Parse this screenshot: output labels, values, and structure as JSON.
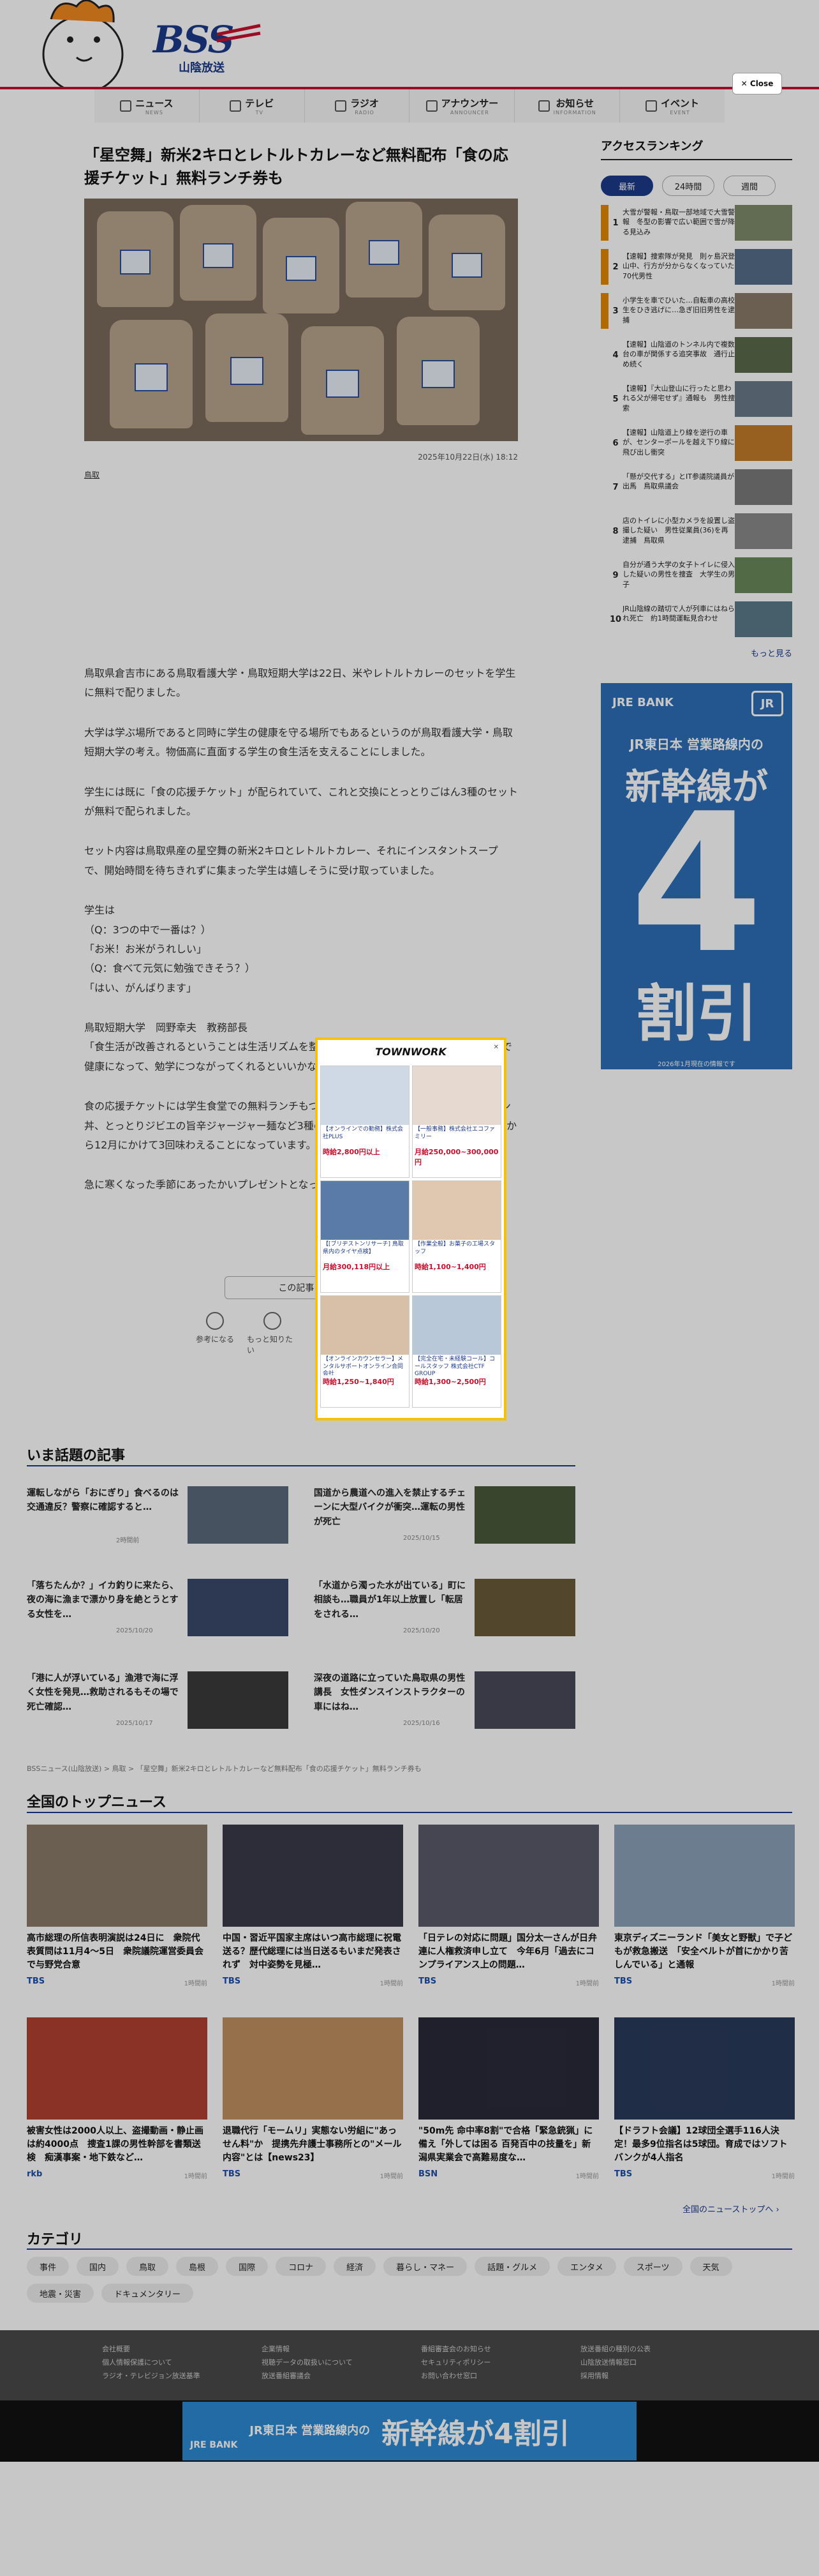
{
  "header": {
    "logo_text": "BSS",
    "logo_sub": "山陰放送",
    "close_label": "Close",
    "nav": [
      {
        "ja": "ニュース",
        "en": "NEWS",
        "icon": "tv-icon"
      },
      {
        "ja": "テレビ",
        "en": "TV",
        "icon": "tv-icon"
      },
      {
        "ja": "ラジオ",
        "en": "RADIO",
        "icon": "radio-icon"
      },
      {
        "ja": "アナウンサー",
        "en": "ANNOUNCER",
        "icon": "mic-icon"
      },
      {
        "ja": "お知らせ",
        "en": "INFORMATION",
        "icon": "info-icon"
      },
      {
        "ja": "イベント",
        "en": "EVENT",
        "icon": "calendar-icon"
      }
    ]
  },
  "article": {
    "title": "「星空舞」新米2キロとレトルトカレーなど無料配布「食の応援チケット」無料ランチ券も",
    "date": "2025年10月22日(水) 18:12",
    "tag": "鳥取",
    "paragraphs": [
      "鳥取県倉吉市にある鳥取看護大学・鳥取短期大学は22日、米やレトルトカレーのセットを学生に無料で配りました。",
      "大学は学ぶ場所であると同時に学生の健康を守る場所でもあるというのが鳥取看護大学・鳥取短期大学の考え。物価高に直面する学生の食生活を支えることにしました。",
      "学生には既に「食の応援チケット」が配られていて、これと交換にとっとりごはん3種のセットが無料で配られました。",
      "セット内容は鳥取県産の星空舞の新米2キロとレトルトカレー、それにインスタントスープで、開始時間を待ちきれずに集まった学生は嬉しそうに受け取っていました。",
      "学生は\n（Q：3つの中で一番は？）\n「お米！お米がうれしい」\n（Q：食べて元気に勉強できそう？）\n「はい、がんばります」",
      "鳥取短期大学　岡野幸夫　教務部長\n「食生活が改善されるということは生活リズムを整えることにもつながる。そうしたところで健康になって、勉学につながってくれるといいかなと」",
      "食の応援チケットには学生食堂での無料ランチもついていて、学生は鳥取名物の牛骨ラーメン丼、とっとりジビエの旨辛ジャージャー麺など3種の中から選べます。この無料ランチが来月から12月にかけて3回味わえることになっています。",
      "急に寒くなった季節にあったかいプレゼントとなったようです。"
    ],
    "share_label": "この記事を読んで",
    "reactions": [
      "参考になる",
      "もっと知りたい"
    ]
  },
  "ranking": {
    "title": "アクセスランキング",
    "tabs": [
      "最新",
      "24時間",
      "週間"
    ],
    "active_tab": "最新",
    "items": [
      {
        "rank": "1",
        "text": "大雪が警報・鳥取一部地域で大雪警報　冬型の影響で広い範囲で雪が降る見込み"
      },
      {
        "rank": "2",
        "text": "【速報】捜索隊が発見　則ヶ島沢登山中、行方が分からなくなっていた70代男性"
      },
      {
        "rank": "3",
        "text": "小学生を車でひいた…自転車の高校生をひき逃げに…急ぎ旧旧男性を逮捕"
      },
      {
        "rank": "4",
        "text": "【速報】山陰道のトンネル内で複数台の車が関係する追突事故　通行止め続く"
      },
      {
        "rank": "5",
        "text": "【速報】『大山登山に行ったと思われる父が帰宅せず』通報も　男性捜索"
      },
      {
        "rank": "6",
        "text": "【速報】山陰道上り線を逆行の車が、センターポールを越え下り線に飛び出し衝突"
      },
      {
        "rank": "7",
        "text": "「懸が交代する」とIT参議院議員が出馬　鳥取県議会"
      },
      {
        "rank": "8",
        "text": "店のトイレに小型カメラを設置し盗撮した疑い　男性従業員(36)を再逮捕　鳥取県"
      },
      {
        "rank": "9",
        "text": "自分が通う大学の女子トイレに侵入した疑いの男性を捜査　大学生の男子"
      },
      {
        "rank": "10",
        "text": "JR山陰線の踏切で人が列車にはねられ死亡　約1時間運転見合わせ"
      }
    ],
    "more_label": "もっと見る"
  },
  "sidebar_ad": {
    "brand": "JRE BANK",
    "logo": "JR",
    "line1": "JR東日本 営業路線内の",
    "line2": "新幹線が",
    "big": "4",
    "line3": "割引",
    "note": "2026年1月現在の情報です"
  },
  "modal_ad": {
    "brand": "TOWNWORK",
    "close": "✕",
    "cards": [
      {
        "title": "【オンラインでの勤務】株式会社PLUS",
        "wage": "時給2,800円以上"
      },
      {
        "title": "【一般事務】株式会社エコファミリー",
        "wage": "月給250,000~300,000円"
      },
      {
        "title": "【[ブリヂストンリサーチ] 鳥取県内のタイヤ点検】",
        "wage": "月給300,118円以上"
      },
      {
        "title": "【作業全般】お菓子の工場スタッフ",
        "wage": "時給1,100~1,400円"
      },
      {
        "title": "【オンラインカウンセラー】メンタルサポートオンライン合同会社",
        "wage": "時給1,250~1,840円"
      },
      {
        "title": "【完全在宅・未経験コール】コールスタッフ 株式会社CTF GROUP",
        "wage": "時給1,300~2,500円"
      }
    ]
  },
  "trending": {
    "title": "いま話題の記事",
    "items": [
      {
        "title": "運転しながら「おにぎり」食べるのは交通違反？警察に確認すると…",
        "date": "2時間前"
      },
      {
        "title": "国道から農道への進入を禁止するチェーンに大型バイクが衝突…運転の男性が死亡",
        "date": "2025/10/15"
      },
      {
        "title": "「落ちたんか？」イカ釣りに来たら、夜の海に漁まで漂かり身を絶とうとする女性を…",
        "date": "2025/10/20"
      },
      {
        "title": "「水道から濁った水が出ている」町に相談も…職員が1年以上放置し「転居をされる…",
        "date": "2025/10/20"
      },
      {
        "title": "「港に人が浮いている」漁港で海に浮く女性を発見…救助されるもその場で死亡確認…",
        "date": "2025/10/17"
      },
      {
        "title": "深夜の道路に立っていた鳥取県の男性講長　女性ダンスインストラクターの車にはね…",
        "date": "2025/10/16"
      }
    ]
  },
  "breadcrumbs": "BSSニュース(山陰放送) > 鳥取 > 「星空舞」新米2キロとレトルトカレーなど無料配布「食の応援チケット」無料ランチ券も",
  "top_news": {
    "title": "全国のトップニュース",
    "items": [
      {
        "title": "高市総理の所信表明演説は24日に　衆院代表質問は11月4〜5日　衆院議院運営委員会で与野党合意",
        "src": "TBS",
        "date": "1時間前"
      },
      {
        "title": "中国・習近平国家主席はいつ高市総理に祝電送る？歴代総理には当日送るもいまだ発表されず　対中姿勢を見極…",
        "src": "TBS",
        "date": "1時間前"
      },
      {
        "title": "「日テレの対応に問題」国分太一さんが日弁連に人権救済申し立て　今年6月「過去にコンプライアンス上の問題…",
        "src": "TBS",
        "date": "1時間前"
      },
      {
        "title": "東京ディズニーランド「美女と野獣」で子どもが救急搬送　「安全ベルトが首にかかり苦しんでいる」と通報",
        "src": "TBS",
        "date": "1時間前"
      },
      {
        "title": "被害女性は2000人以上、盗撮動画・静止画は約4000点　捜査1課の男性幹部を書類送検　痴漢事案・地下鉄など…",
        "src": "rkb",
        "date": "1時間前"
      },
      {
        "title": "退職代行「モームリ」実態ない労組に\"あっせん料\"か　提携先弁護士事務所との\"メール内容\"とは【news23】",
        "src": "TBS",
        "date": "1時間前"
      },
      {
        "title": "\"50m先 命中率8割\"で合格「緊急銃猟」に備え「外しては困る 百発百中の技量を」新潟県実業会で高難易度な…",
        "src": "BSN",
        "date": "1時間前"
      },
      {
        "title": "【ドラフト会議】12球団全選手116人決定！最多9位指名は5球団。育成ではソフトバンクが4人指名",
        "src": "TBS",
        "date": "1時間前"
      }
    ],
    "all_label": "全国のニューストップへ ›"
  },
  "categories": {
    "title": "カテゴリ",
    "items": [
      "事件",
      "国内",
      "鳥取",
      "島根",
      "国際",
      "コロナ",
      "経済",
      "暮らし・マネー",
      "話題・グルメ",
      "エンタメ",
      "スポーツ",
      "天気",
      "地震・災害",
      "ドキュメンタリー"
    ]
  },
  "footer": {
    "cols": [
      [
        "会社概要",
        "個人情報保護について",
        "ラジオ・テレビジョン放送基準"
      ],
      [
        "企業情報",
        "視聴データの取扱いについて",
        "放送番組審議会"
      ],
      [
        "番組審査会のお知らせ",
        "セキュリティポリシー",
        "お問い合わせ窓口"
      ],
      [
        "放送番組の種別の公表",
        "山陰放送情報窓口",
        "採用情報"
      ]
    ]
  },
  "bottom_ad": {
    "brand": "JRE BANK",
    "small": "JR東日本 営業路線内の",
    "main": "新幹線が4割引"
  }
}
